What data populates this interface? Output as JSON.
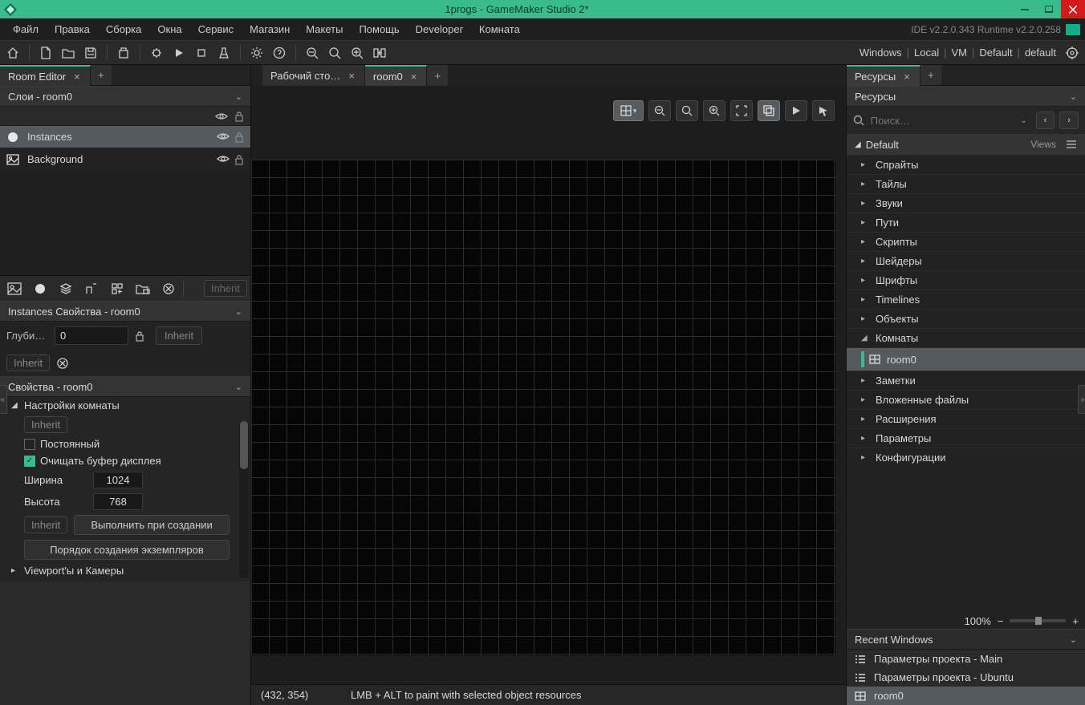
{
  "titlebar": {
    "title": "1progs - GameMaker Studio 2*"
  },
  "menubar": {
    "items": [
      "Файл",
      "Правка",
      "Сборка",
      "Окна",
      "Сервис",
      "Магазин",
      "Макеты",
      "Помощь",
      "Developer",
      "Комната"
    ],
    "version": "IDE v2.2.0.343 Runtime v2.2.0.258"
  },
  "targets": [
    "Windows",
    "Local",
    "VM",
    "Default",
    "default"
  ],
  "left": {
    "tab": "Room Editor",
    "layers_header": "Слои - room0",
    "layers": [
      {
        "name": "Instances",
        "selected": true,
        "icon": "circle"
      },
      {
        "name": "Background",
        "selected": false,
        "icon": "image"
      }
    ],
    "layer_toolbar_inherit": "Inherit",
    "instances_header": "Instances Свойства - room0",
    "depth_label": "Глуби…",
    "depth_value": "0",
    "inherit_label": "Inherit",
    "room_props_header": "Свойства - room0",
    "room_settings_label": "Настройки комнаты",
    "persistent_label": "Постоянный",
    "clear_buffer_label": "Очищать буфер дисплея",
    "width_label": "Ширина",
    "width_value": "1024",
    "height_label": "Высота",
    "height_value": "768",
    "creation_code_btn": "Выполнить при создании",
    "instance_order_btn": "Порядок создания экземпляров",
    "viewports_label": "Viewport'ы и Камеры"
  },
  "center": {
    "tabs": [
      {
        "label": "Рабочий сто…",
        "active": false
      },
      {
        "label": "room0",
        "active": true
      }
    ],
    "status_coords": "(432, 354)",
    "status_hint": "LMB + ALT to paint with selected object resources"
  },
  "right": {
    "tab": "Ресурсы",
    "header": "Ресурсы",
    "search_placeholder": "Поиск…",
    "default_label": "Default",
    "views_label": "Views",
    "tree": [
      {
        "label": "Спрайты",
        "expanded": false
      },
      {
        "label": "Тайлы",
        "expanded": false
      },
      {
        "label": "Звуки",
        "expanded": false
      },
      {
        "label": "Пути",
        "expanded": false
      },
      {
        "label": "Скрипты",
        "expanded": false
      },
      {
        "label": "Шейдеры",
        "expanded": false
      },
      {
        "label": "Шрифты",
        "expanded": false
      },
      {
        "label": "Timelines",
        "expanded": false
      },
      {
        "label": "Объекты",
        "expanded": false
      },
      {
        "label": "Комнаты",
        "expanded": true,
        "children": [
          {
            "label": "room0"
          }
        ]
      },
      {
        "label": "Заметки",
        "expanded": false
      },
      {
        "label": "Вложенные файлы",
        "expanded": false
      },
      {
        "label": "Расширения",
        "expanded": false
      },
      {
        "label": "Параметры",
        "expanded": false
      },
      {
        "label": "Конфигурации",
        "expanded": false
      }
    ],
    "zoom": "100%",
    "recent_header": "Recent Windows",
    "recent": [
      {
        "label": "Параметры проекта - Main",
        "icon": "list",
        "active": false
      },
      {
        "label": "Параметры проекта - Ubuntu",
        "icon": "list",
        "active": false
      },
      {
        "label": "room0",
        "icon": "room",
        "active": true
      }
    ]
  }
}
